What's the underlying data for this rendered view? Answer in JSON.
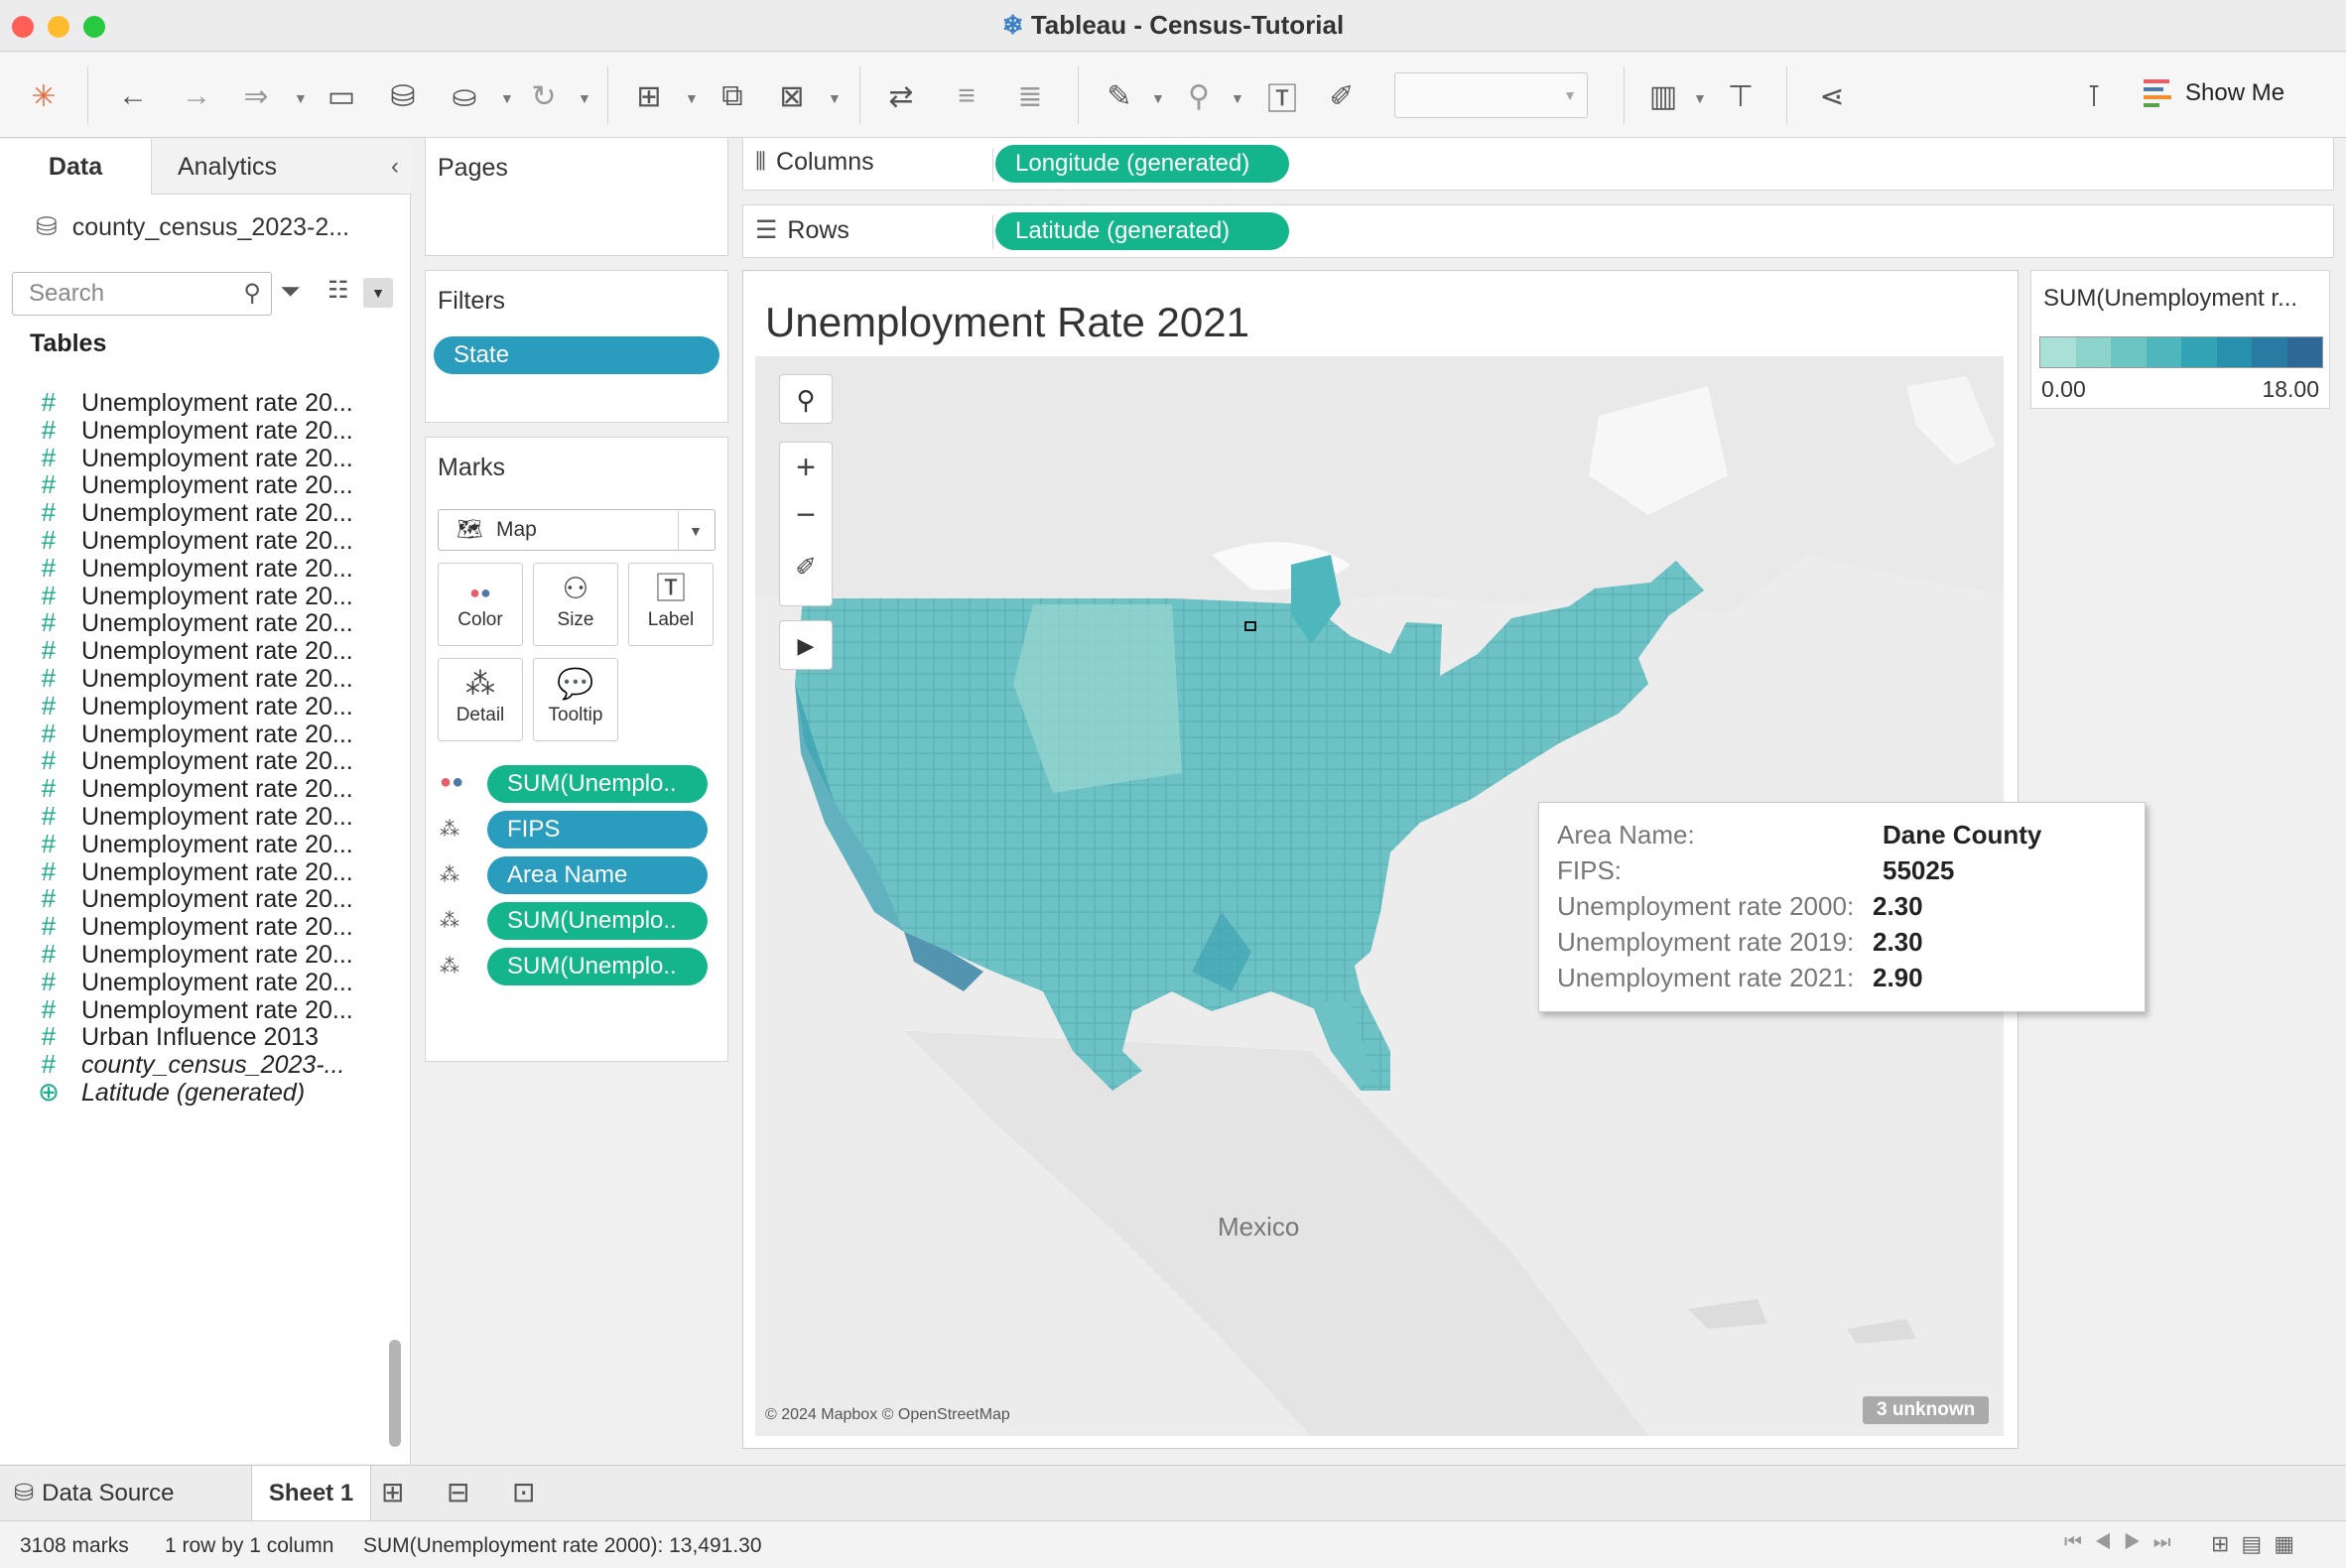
{
  "window": {
    "title": "Tableau - Census-Tutorial"
  },
  "toolbar": {
    "show_me": "Show Me"
  },
  "data_pane": {
    "tab_data": "Data",
    "tab_analytics": "Analytics",
    "datasource": "county_census_2023-2...",
    "search_placeholder": "Search",
    "tables_header": "Tables",
    "items": [
      {
        "label": "Unemployment rate 20...",
        "type": "measure"
      },
      {
        "label": "Unemployment rate 20...",
        "type": "measure"
      },
      {
        "label": "Unemployment rate 20...",
        "type": "measure"
      },
      {
        "label": "Unemployment rate 20...",
        "type": "measure"
      },
      {
        "label": "Unemployment rate 20...",
        "type": "measure"
      },
      {
        "label": "Unemployment rate 20...",
        "type": "measure"
      },
      {
        "label": "Unemployment rate 20...",
        "type": "measure"
      },
      {
        "label": "Unemployment rate 20...",
        "type": "measure"
      },
      {
        "label": "Unemployment rate 20...",
        "type": "measure"
      },
      {
        "label": "Unemployment rate 20...",
        "type": "measure"
      },
      {
        "label": "Unemployment rate 20...",
        "type": "measure"
      },
      {
        "label": "Unemployment rate 20...",
        "type": "measure"
      },
      {
        "label": "Unemployment rate 20...",
        "type": "measure"
      },
      {
        "label": "Unemployment rate 20...",
        "type": "measure"
      },
      {
        "label": "Unemployment rate 20...",
        "type": "measure"
      },
      {
        "label": "Unemployment rate 20...",
        "type": "measure"
      },
      {
        "label": "Unemployment rate 20...",
        "type": "measure"
      },
      {
        "label": "Unemployment rate 20...",
        "type": "measure"
      },
      {
        "label": "Unemployment rate 20...",
        "type": "measure"
      },
      {
        "label": "Unemployment rate 20...",
        "type": "measure"
      },
      {
        "label": "Unemployment rate 20...",
        "type": "measure"
      },
      {
        "label": "Unemployment rate 20...",
        "type": "measure"
      },
      {
        "label": "Unemployment rate 20...",
        "type": "measure"
      },
      {
        "label": "Urban Influence 2013",
        "type": "measure"
      },
      {
        "label": "county_census_2023-...",
        "type": "measure-italic"
      },
      {
        "label": "Latitude (generated)",
        "type": "geo-italic"
      }
    ]
  },
  "pages": {
    "title": "Pages"
  },
  "filters": {
    "title": "Filters",
    "pills": [
      "State"
    ]
  },
  "marks": {
    "title": "Marks",
    "type": "Map",
    "buttons": {
      "color": "Color",
      "size": "Size",
      "label": "Label",
      "detail": "Detail",
      "tooltip": "Tooltip"
    },
    "pills": [
      {
        "label": "SUM(Unemplo..",
        "icon": "color",
        "kind": "measure"
      },
      {
        "label": "FIPS",
        "icon": "detail",
        "kind": "dimension"
      },
      {
        "label": "Area Name",
        "icon": "detail",
        "kind": "dimension"
      },
      {
        "label": "SUM(Unemplo..",
        "icon": "detail",
        "kind": "measure"
      },
      {
        "label": "SUM(Unemplo..",
        "icon": "detail",
        "kind": "measure"
      }
    ]
  },
  "shelves": {
    "columns_label": "Columns",
    "columns_pill": "Longitude (generated)",
    "rows_label": "Rows",
    "rows_pill": "Latitude (generated)"
  },
  "view": {
    "title": "Unemployment Rate 2021",
    "mexico_label": "Mexico",
    "attribution": "© 2024 Mapbox © OpenStreetMap",
    "unknown_badge": "3 unknown"
  },
  "tooltip": {
    "rows": [
      {
        "label": "Area Name:",
        "value": "Dane County"
      },
      {
        "label": "FIPS:",
        "value": "55025"
      },
      {
        "label": "Unemployment rate 2000:",
        "value": "2.30"
      },
      {
        "label": "Unemployment rate 2019:",
        "value": "2.30"
      },
      {
        "label": "Unemployment rate 2021:",
        "value": "2.90"
      }
    ]
  },
  "legend": {
    "title": "SUM(Unemployment r...",
    "min": "0.00",
    "max": "18.00",
    "colors": [
      "#a9e0d7",
      "#8bd3cb",
      "#6cc5c3",
      "#4eb6bd",
      "#33a3b6",
      "#2790ad",
      "#2a7ba3",
      "#2d6897"
    ]
  },
  "tabs": {
    "data_source": "Data Source",
    "sheet": "Sheet 1"
  },
  "status": {
    "marks": "3108 marks",
    "dims": "1 row by 1 column",
    "sum": "SUM(Unemployment rate 2000): 13,491.30"
  },
  "colors": {
    "measure_pill": "#14b58c",
    "dimension_pill": "#2a9dbf",
    "filter_pill": "#2a9dbf"
  }
}
